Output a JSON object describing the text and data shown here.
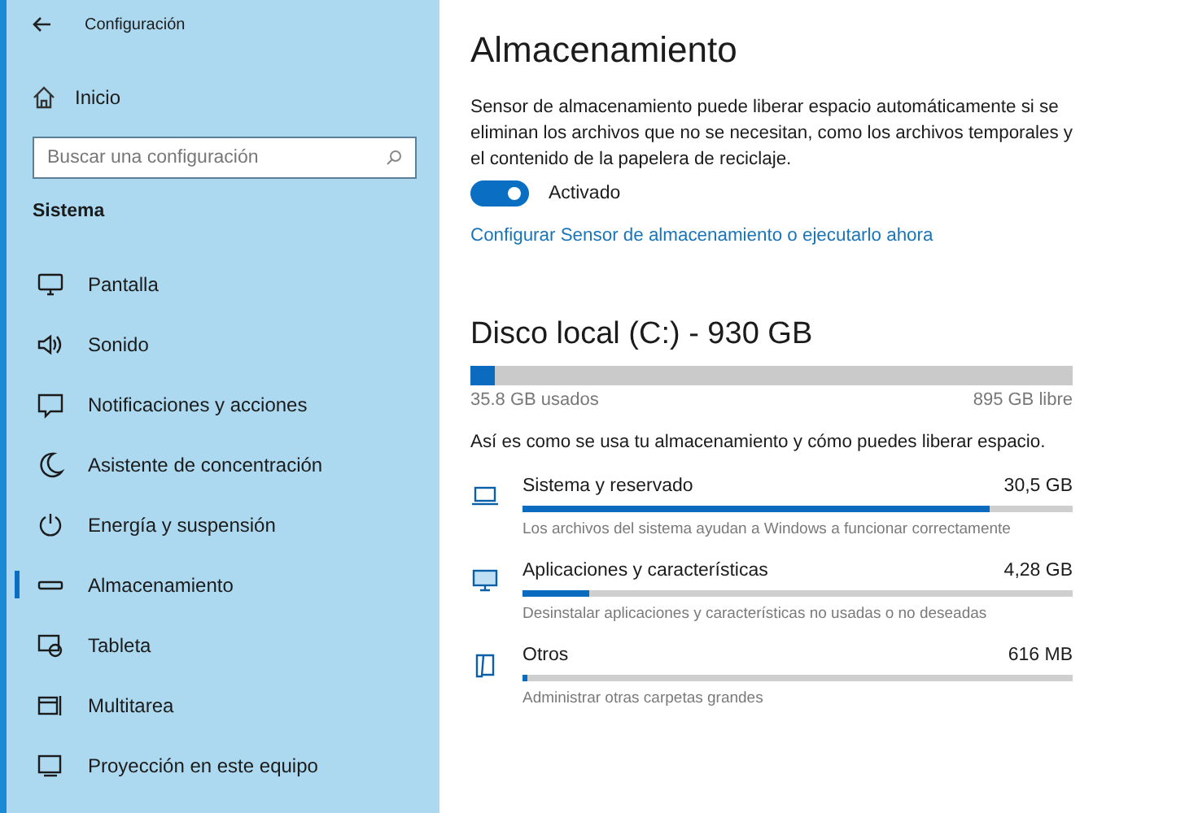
{
  "window": {
    "title": "Configuración"
  },
  "sidebar": {
    "home": "Inicio",
    "search": {
      "placeholder": "Buscar una configuración"
    },
    "section": "Sistema",
    "items": [
      {
        "kind": "display",
        "label": "Pantalla",
        "selected": false
      },
      {
        "kind": "sound",
        "label": "Sonido",
        "selected": false
      },
      {
        "kind": "notifications",
        "label": "Notificaciones y acciones",
        "selected": false
      },
      {
        "kind": "focus",
        "label": "Asistente de concentración",
        "selected": false
      },
      {
        "kind": "power",
        "label": "Energía y suspensión",
        "selected": false
      },
      {
        "kind": "storage",
        "label": "Almacenamiento",
        "selected": true
      },
      {
        "kind": "tablet",
        "label": "Tableta",
        "selected": false
      },
      {
        "kind": "multitask",
        "label": "Multitarea",
        "selected": false
      },
      {
        "kind": "project",
        "label": "Proyección en este equipo",
        "selected": false
      }
    ]
  },
  "main": {
    "title": "Almacenamiento",
    "description": "Sensor de almacenamiento puede liberar espacio automáticamente si se eliminan los archivos que no se necesitan, como los archivos temporales y el contenido de la papelera de reciclaje.",
    "toggle": {
      "label": "Activado",
      "on": true
    },
    "link": "Configurar Sensor de almacenamiento o ejecutarlo ahora",
    "drive": {
      "title": "Disco local (C:) - 930 GB",
      "level": 0.04,
      "used": "35.8 GB usados",
      "free": "895 GB libre"
    },
    "intro": "Así es como se usa tu almacenamiento y cómo puedes liberar espacio.",
    "categories": [
      {
        "kind": "laptop",
        "name": "Sistema y reservado",
        "size": "30,5 GB",
        "level": 0.85,
        "description": "Los archivos del sistema ayudan a Windows a funcionar correctamente"
      },
      {
        "kind": "desktop",
        "name": "Aplicaciones y características",
        "size": "4,28 GB",
        "level": 0.12,
        "description": "Desinstalar aplicaciones y características no usadas o no deseadas"
      },
      {
        "kind": "folder",
        "name": "Otros",
        "size": "616 MB",
        "level": 0.01,
        "description": "Administrar otras carpetas grandes"
      }
    ]
  }
}
